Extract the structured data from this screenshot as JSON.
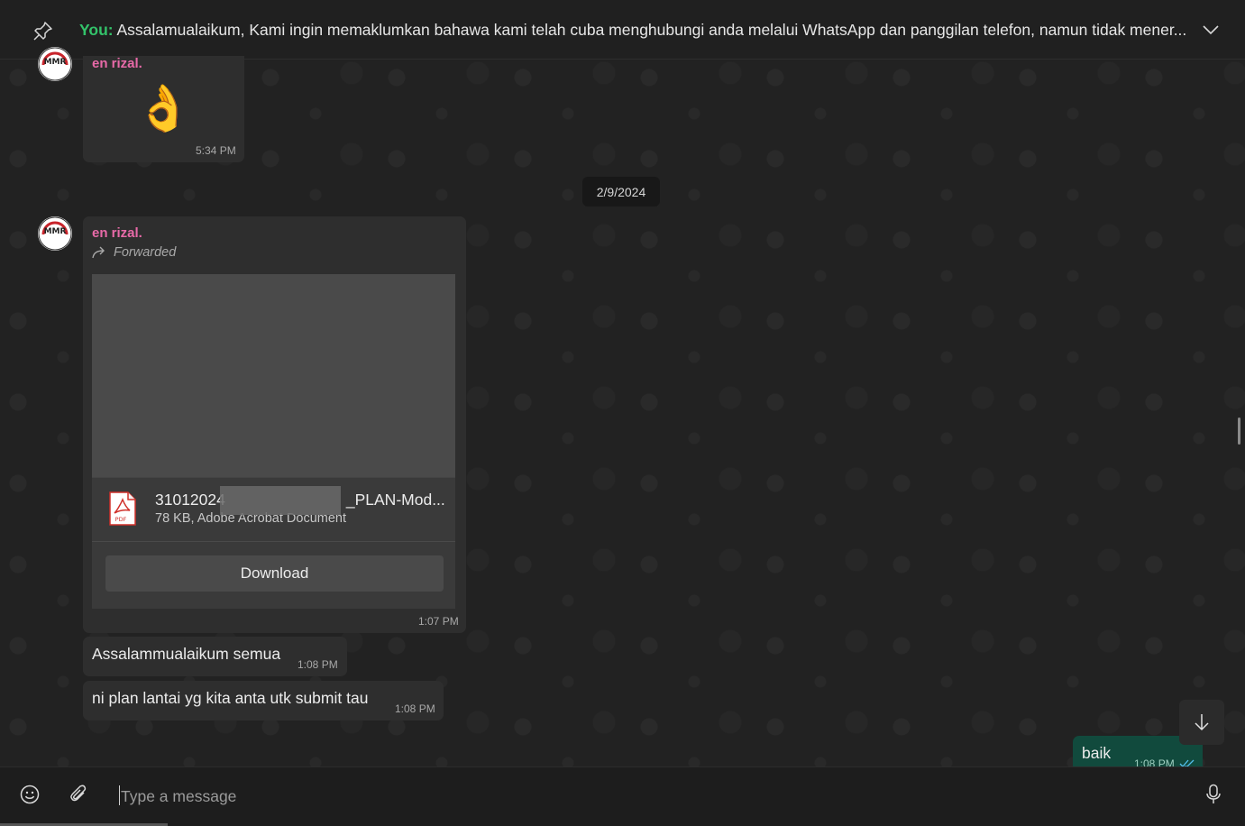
{
  "pinned": {
    "author": "You:",
    "text": " Assalamualaikum,  Kami ingin memaklumkan bahawa kami telah cuba menghubungi anda melalui WhatsApp dan panggilan telefon, namun tidak mener..."
  },
  "messages": {
    "sticker_msg": {
      "sender": "en rizal.",
      "emoji": "👌",
      "time": "5:34 PM"
    },
    "date_chip": "2/9/2024",
    "doc_msg": {
      "sender": "en rizal.",
      "forwarded_label": "Forwarded",
      "file_name_start": "31012024",
      "file_name_end": "_PLAN-Mod...",
      "file_meta": "78 KB, Adobe Acrobat Document",
      "file_type_badge": "PDF",
      "download_label": "Download",
      "time": "1:07 PM"
    },
    "text_msg_1": {
      "text": "Assalammualaikum semua",
      "time": "1:08 PM"
    },
    "text_msg_2": {
      "text": "ni plan lantai yg kita anta utk submit tau",
      "time": "1:08 PM"
    },
    "outgoing": {
      "text": "baik",
      "time": "1:08 PM"
    }
  },
  "avatar_label": "MMR",
  "composer": {
    "placeholder": "Type a message"
  },
  "colors": {
    "accent_green": "#33c36a",
    "sender_pink": "#e86aa8",
    "outgoing_bubble": "#114a3d"
  },
  "icons": [
    "pin-icon",
    "chevron-down-icon",
    "forward-icon",
    "pdf-icon",
    "arrow-down-icon",
    "emoji-icon",
    "attach-icon",
    "mic-icon"
  ]
}
